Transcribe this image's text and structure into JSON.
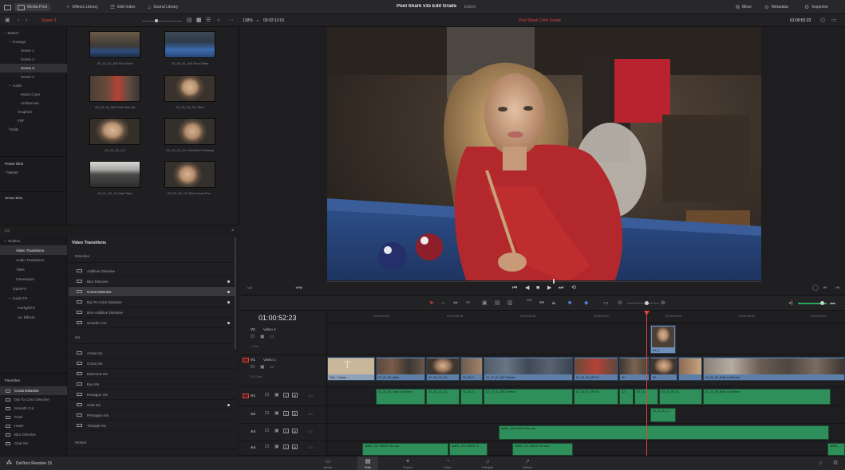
{
  "app": {
    "name": "DaVinci Resolve 15"
  },
  "topbar": {
    "media_pool": "Media Pool",
    "effects_library": "Effects Library",
    "edit_index": "Edit Index",
    "sound_library": "Sound Library",
    "project_title": "Pool Shark v15 Edit Grade",
    "project_status": "Edited",
    "mixer": "Mixer",
    "metadata": "Metadata",
    "inspector": "Inspector"
  },
  "subbar": {
    "bin_name": "Scene 3",
    "zoom": "138%",
    "timecode_left": "00:02:12:01",
    "timeline_name": "Pool Shark Color Grade",
    "timecode_right": "01:00:52:23"
  },
  "bins": {
    "items": [
      "Master",
      "Footage",
      "Scene 1",
      "Scene 2",
      "Scene 3",
      "Scene 4",
      "Audio",
      "Music Cues",
      "Ambiences",
      "Graphics",
      "FEF",
      "Edits"
    ],
    "selected_index": 4,
    "power_bins": "Power Bins",
    "power_master": "Master",
    "smart_bins": "Smart Bins"
  },
  "pool": {
    "clips": [
      "03_16_01_MS Pool Shot",
      "03_08_01_WS Pool Table",
      "03_09_04_MS Pool Shot Alt",
      "03_26_01_CU Shot",
      "03_24_02_CU",
      "03_25_01_CU Shot Bad Framing",
      "03_21_02_CU Bad Take",
      "03_23_02_CU Shot Good Fra..."
    ]
  },
  "toolbox": {
    "items": [
      "Toolbox",
      "Video Transitions",
      "Audio Transitions",
      "Titles",
      "Generators",
      "OpenFX",
      "Audio FX",
      "FairlightFX",
      "AU Effects"
    ],
    "selected_index": 1
  },
  "effects": {
    "heading": "Video Transitions",
    "section_dissolve": "Dissolve",
    "dissolve": [
      "Additive Dissolve",
      "Blur Dissolve",
      "Cross Dissolve",
      "Dip To Color Dissolve",
      "Non-Additive Dissolve",
      "Smooth Cut"
    ],
    "dissolve_selected": 2,
    "section_iris": "Iris",
    "iris": [
      "Arrow Iris",
      "Cross Iris",
      "Diamond Iris",
      "Eye Iris",
      "Hexagon Iris",
      "Oval Iris",
      "Pentagon Iris",
      "Triangle Iris"
    ],
    "section_motion": "Motion"
  },
  "favorites": {
    "title": "Favorites",
    "items": [
      "Cross Dissolve",
      "Dip To Color Dissolve",
      "Smooth Cut",
      "Push",
      "Heart",
      "Blur Dissolve",
      "Oval Iris"
    ],
    "selected_index": 0
  },
  "timeline": {
    "timecode": "01:00:52:23",
    "ruler": [
      "01:00:34:20",
      "01:00:39:16",
      "01:00:44:11",
      "01:00:49:07",
      "01:00:54:02",
      "01:00:58:22",
      "01:01:03:17"
    ],
    "tracks": [
      {
        "id": "V2",
        "name": "Video 2",
        "info": "1 Clip"
      },
      {
        "id": "V1",
        "name": "Video 1",
        "info": "30 Clips"
      },
      {
        "id": "A1",
        "name": "",
        "info": "2.0"
      },
      {
        "id": "A2",
        "name": "",
        "info": "2.0"
      },
      {
        "id": "A3",
        "name": "",
        "info": "2.0"
      },
      {
        "id": "A4",
        "name": "",
        "info": "2.0"
      }
    ],
    "v1_clips": [
      "Text - Caviar...",
      "02_25_06_Walk...",
      "02_25_13_CU...",
      "02_36.2...",
      "02_27_01_WS Exterior",
      "02_18_01_MS Po...",
      "02...",
      "02...",
      "02_25_06_Walk to Exterior"
    ],
    "a1_clips": [
      "02_25_06_Walk to Exterior",
      "02_25_13_CU...",
      "02_36.2...",
      "02_27_01_WS Exterior",
      "02_18_01_MS Po...",
      "02...",
      "02_14...",
      "03_20_06_M...",
      "02_25_06_Walk to Exterior"
    ],
    "a3_clip": "AMB1_005-WAVE File.wav",
    "a4_clips": [
      "AMB1_021-WAVE File.wav",
      "AMB1_021-WAVE Fil...",
      "AMB1_021-WAVE File.wav",
      "AMB1_..."
    ],
    "v2_clip": "03_2...",
    "a2_small": "03_24_01_C..."
  },
  "pages": {
    "items": [
      "Media",
      "Edit",
      "Fusion",
      "Color",
      "Fairlight",
      "Deliver"
    ],
    "selected_index": 1
  },
  "colors": {
    "accent_red": "#e0433c",
    "video_clip": "#5d7fa8",
    "audio_clip": "#2f8f5a"
  }
}
